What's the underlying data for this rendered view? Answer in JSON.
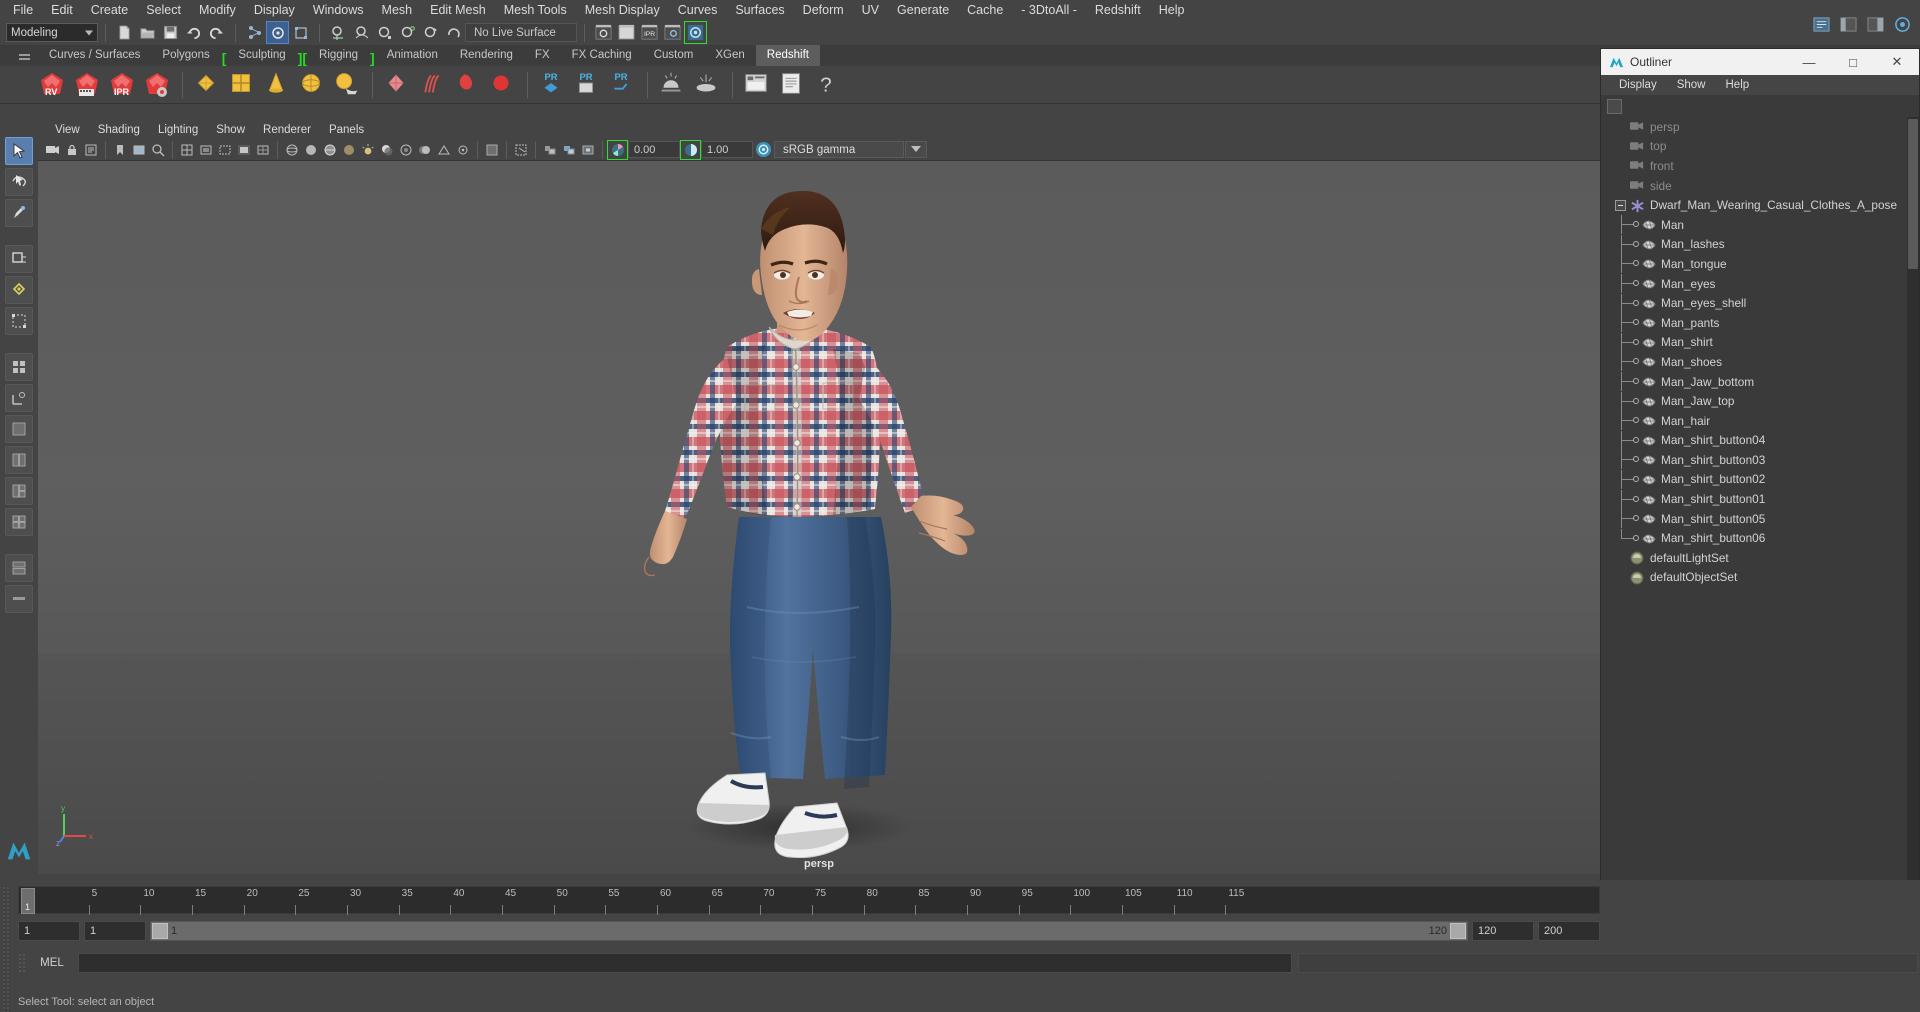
{
  "app": {
    "name": "Autodesk Maya",
    "menus": [
      "File",
      "Edit",
      "Create",
      "Select",
      "Modify",
      "Display",
      "Windows",
      "Mesh",
      "Edit Mesh",
      "Mesh Tools",
      "Mesh Display",
      "Curves",
      "Surfaces",
      "Deform",
      "UV",
      "Generate",
      "Cache",
      "- 3DtoAll -",
      "Redshift",
      "Help"
    ]
  },
  "statusbar": {
    "mode": "Modeling",
    "live_surface": "No Live Surface",
    "icons": [
      "new-scene-icon",
      "open-scene-icon",
      "save-scene-icon",
      "undo-icon",
      "redo-icon",
      "select-by-hierarchy-icon",
      "select-by-object-icon",
      "select-by-component-icon",
      "snap-to-grid-icon",
      "snap-to-curve-icon",
      "snap-to-point-icon",
      "snap-to-projected-center-icon",
      "snap-to-view-plane-icon",
      "make-live-icon",
      "render-view-icon",
      "render-current-frame-icon",
      "ipr-render-icon",
      "render-settings-icon",
      "toggle-ipr-icon"
    ]
  },
  "shelf": {
    "tabs": [
      "Curves / Surfaces",
      "Polygons",
      "Sculpting",
      "Rigging",
      "Animation",
      "Rendering",
      "FX",
      "FX Caching",
      "Custom",
      "XGen",
      "Redshift"
    ],
    "active_tab": "Redshift",
    "bracketed": [
      "Sculpting",
      "Rigging"
    ],
    "icons": [
      "redshift-rv-icon",
      "redshift-render-sequence-icon",
      "redshift-ipr-icon",
      "redshift-render-settings-icon",
      "poly-plane-icon",
      "poly-cube-icon",
      "poly-cone-icon",
      "poly-sphere-icon",
      "poly-cylinder-icon",
      "redshift-proxy-icon",
      "redshift-hair-icon",
      "redshift-volume-icon",
      "redshift-light-icon",
      "pr-material-icon",
      "pr-texture-icon",
      "pr-utility-icon",
      "redshift-dome-light-icon",
      "redshift-area-light-icon",
      "redshift-render-view-icon",
      "redshift-log-icon",
      "redshift-help-icon"
    ]
  },
  "tool_column": {
    "tools": [
      "select-tool",
      "lasso-select-tool",
      "paint-select-tool",
      "move-tool",
      "rotate-tool",
      "scale-tool",
      "soft-modification-tool",
      "show-manipulator-tool",
      "last-tool-used"
    ],
    "active": "select-tool"
  },
  "viewport": {
    "menus": [
      "View",
      "Shading",
      "Lighting",
      "Show",
      "Renderer",
      "Panels"
    ],
    "camera_label": "persp",
    "exposure_value": "0.00",
    "gamma_value": "1.00",
    "color_management": "sRGB gamma",
    "axis": {
      "x": "x",
      "y": "y",
      "z": "z"
    },
    "toolbar_icons": [
      "select-camera-icon",
      "lock-camera-icon",
      "camera-attributes-icon",
      "bookmarks-icon",
      "image-plane-icon",
      "2d-pan-zoom-icon",
      "grid-toggle-icon",
      "film-gate-icon",
      "resolution-gate-icon",
      "gate-mask-icon",
      "field-chart-icon",
      "safe-action-icon",
      "safe-title-icon",
      "wireframe-icon",
      "smooth-shade-icon",
      "shaded-wireframe-icon",
      "hardware-texturing-icon",
      "use-default-lighting-icon",
      "shadows-icon",
      "ambient-occlusion-icon",
      "motion-blur-icon",
      "multisample-icon",
      "depth-of-field-icon",
      "isolate-select-icon",
      "xray-icon",
      "xray-joints-icon",
      "xray-active-components-icon",
      "exposure-icon",
      "gamma-icon",
      "color-management-icon"
    ]
  },
  "outliner": {
    "title": "Outliner",
    "icon": "maya-outliner-icon",
    "window_buttons": [
      "minimize-button",
      "maximize-button",
      "close-button"
    ],
    "menus": [
      "Display",
      "Show",
      "Help"
    ],
    "items": [
      {
        "label": "persp",
        "icon": "camera-icon",
        "depth": 0,
        "dim": true,
        "tree": "none"
      },
      {
        "label": "top",
        "icon": "camera-icon",
        "depth": 0,
        "dim": true,
        "tree": "none"
      },
      {
        "label": "front",
        "icon": "camera-icon",
        "depth": 0,
        "dim": true,
        "tree": "none"
      },
      {
        "label": "side",
        "icon": "camera-icon",
        "depth": 0,
        "dim": true,
        "tree": "none"
      },
      {
        "label": "Dwarf_Man_Wearing_Casual_Clothes_A_pose",
        "icon": "group-icon",
        "depth": 0,
        "dim": false,
        "tree": "expand"
      },
      {
        "label": "Man",
        "icon": "mesh-icon",
        "depth": 1,
        "dim": false,
        "tree": "child"
      },
      {
        "label": "Man_lashes",
        "icon": "mesh-icon",
        "depth": 1,
        "dim": false,
        "tree": "child"
      },
      {
        "label": "Man_tongue",
        "icon": "mesh-icon",
        "depth": 1,
        "dim": false,
        "tree": "child"
      },
      {
        "label": "Man_eyes",
        "icon": "mesh-icon",
        "depth": 1,
        "dim": false,
        "tree": "child"
      },
      {
        "label": "Man_eyes_shell",
        "icon": "mesh-icon",
        "depth": 1,
        "dim": false,
        "tree": "child"
      },
      {
        "label": "Man_pants",
        "icon": "mesh-icon",
        "depth": 1,
        "dim": false,
        "tree": "child"
      },
      {
        "label": "Man_shirt",
        "icon": "mesh-icon",
        "depth": 1,
        "dim": false,
        "tree": "child"
      },
      {
        "label": "Man_shoes",
        "icon": "mesh-icon",
        "depth": 1,
        "dim": false,
        "tree": "child"
      },
      {
        "label": "Man_Jaw_bottom",
        "icon": "mesh-icon",
        "depth": 1,
        "dim": false,
        "tree": "child"
      },
      {
        "label": "Man_Jaw_top",
        "icon": "mesh-icon",
        "depth": 1,
        "dim": false,
        "tree": "child"
      },
      {
        "label": "Man_hair",
        "icon": "mesh-icon",
        "depth": 1,
        "dim": false,
        "tree": "child"
      },
      {
        "label": "Man_shirt_button04",
        "icon": "mesh-icon",
        "depth": 1,
        "dim": false,
        "tree": "child"
      },
      {
        "label": "Man_shirt_button03",
        "icon": "mesh-icon",
        "depth": 1,
        "dim": false,
        "tree": "child"
      },
      {
        "label": "Man_shirt_button02",
        "icon": "mesh-icon",
        "depth": 1,
        "dim": false,
        "tree": "child"
      },
      {
        "label": "Man_shirt_button01",
        "icon": "mesh-icon",
        "depth": 1,
        "dim": false,
        "tree": "child"
      },
      {
        "label": "Man_shirt_button05",
        "icon": "mesh-icon",
        "depth": 1,
        "dim": false,
        "tree": "child"
      },
      {
        "label": "Man_shirt_button06",
        "icon": "mesh-icon",
        "depth": 1,
        "dim": false,
        "tree": "childlast"
      },
      {
        "label": "defaultLightSet",
        "icon": "set-icon",
        "depth": 0,
        "dim": false,
        "tree": "none"
      },
      {
        "label": "defaultObjectSet",
        "icon": "set-icon",
        "depth": 0,
        "dim": false,
        "tree": "none"
      }
    ]
  },
  "timeline": {
    "ticks": [
      {
        "label": "5",
        "frame": 5
      },
      {
        "label": "10",
        "frame": 10
      },
      {
        "label": "15",
        "frame": 15
      },
      {
        "label": "20",
        "frame": 20
      },
      {
        "label": "25",
        "frame": 25
      },
      {
        "label": "30",
        "frame": 30
      },
      {
        "label": "35",
        "frame": 35
      },
      {
        "label": "40",
        "frame": 40
      },
      {
        "label": "45",
        "frame": 45
      },
      {
        "label": "50",
        "frame": 50
      },
      {
        "label": "55",
        "frame": 55
      },
      {
        "label": "60",
        "frame": 60
      },
      {
        "label": "65",
        "frame": 65
      },
      {
        "label": "70",
        "frame": 70
      },
      {
        "label": "75",
        "frame": 75
      },
      {
        "label": "80",
        "frame": 80
      },
      {
        "label": "85",
        "frame": 85
      },
      {
        "label": "90",
        "frame": 90
      },
      {
        "label": "95",
        "frame": 95
      },
      {
        "label": "100",
        "frame": 100
      },
      {
        "label": "105",
        "frame": 105
      },
      {
        "label": "110",
        "frame": 110
      },
      {
        "label": "115",
        "frame": 115
      }
    ],
    "current_frame": "1",
    "range_start": "1",
    "range_end": "1",
    "anim_start": "1",
    "anim_end_mid": "120",
    "anim_end": "120",
    "playback_end": "200"
  },
  "command_line": {
    "label": "MEL",
    "value": "",
    "placeholder": ""
  },
  "help_line": {
    "text": "Select Tool: select an object"
  },
  "colors": {
    "accent_green": "#2ee02e",
    "accent_blue": "#5285c4",
    "panel_bg": "#444444",
    "viewport_bg": "#5b5b5b"
  }
}
